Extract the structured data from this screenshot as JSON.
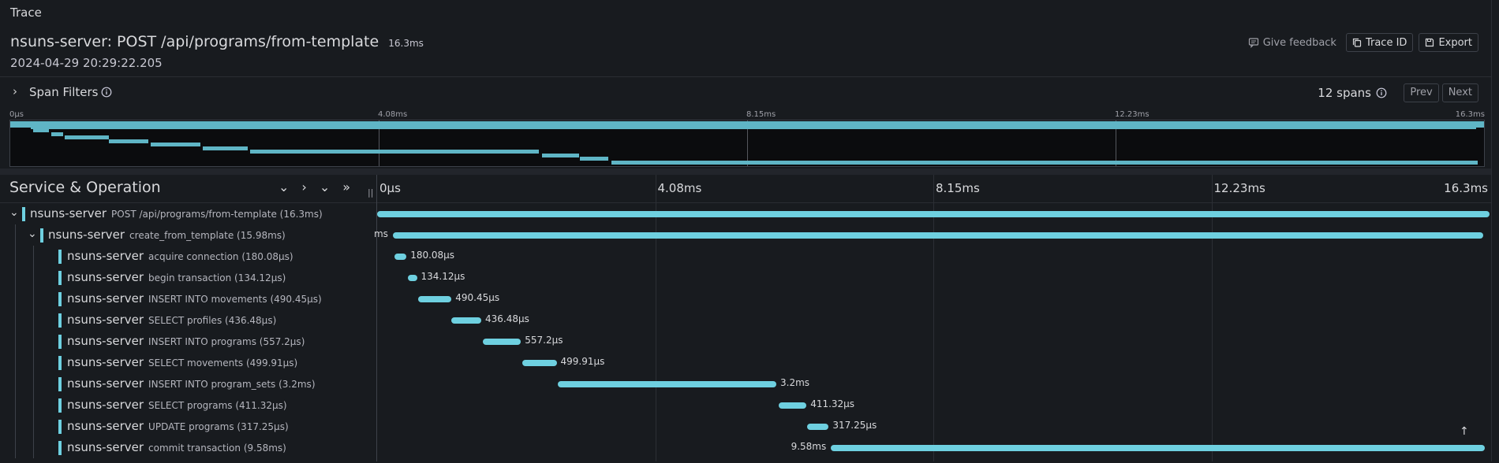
{
  "panel_title": "Trace",
  "header": {
    "service": "nsuns-server:",
    "operation": "POST /api/programs/from-template",
    "duration": "16.3ms",
    "start_time": "2024-04-29 20:29:22.205",
    "feedback_label": "Give feedback",
    "trace_id_label": "Trace ID",
    "export_label": "Export"
  },
  "filters": {
    "label": "Span Filters",
    "spans_count": "12 spans",
    "prev_label": "Prev",
    "next_label": "Next"
  },
  "minimap": {
    "ticks": [
      "0μs",
      "4.08ms",
      "8.15ms",
      "12.23ms",
      "16.3ms"
    ]
  },
  "columns": {
    "service_operation": "Service & Operation",
    "ticks": [
      "0μs",
      "4.08ms",
      "8.15ms",
      "12.23ms",
      "16.3ms"
    ]
  },
  "total_ms": 16.3,
  "spans": [
    {
      "service": "nsuns-server",
      "operation": "POST /api/programs/from-template (16.3ms)",
      "depth": 0,
      "collapsible": true,
      "start_ms": 0.0,
      "duration_ms": 16.3,
      "label": ""
    },
    {
      "service": "nsuns-server",
      "operation": "create_from_template (15.98ms)",
      "depth": 1,
      "collapsible": true,
      "start_ms": 0.23,
      "duration_ms": 15.98,
      "label": "ms"
    },
    {
      "service": "nsuns-server",
      "operation": "acquire connection (180.08μs)",
      "depth": 2,
      "collapsible": false,
      "start_ms": 0.25,
      "duration_ms": 0.18,
      "label": "180.08μs"
    },
    {
      "service": "nsuns-server",
      "operation": "begin transaction (134.12μs)",
      "depth": 2,
      "collapsible": false,
      "start_ms": 0.45,
      "duration_ms": 0.134,
      "label": "134.12μs"
    },
    {
      "service": "nsuns-server",
      "operation": "INSERT INTO movements (490.45μs)",
      "depth": 2,
      "collapsible": false,
      "start_ms": 0.6,
      "duration_ms": 0.49,
      "label": "490.45μs"
    },
    {
      "service": "nsuns-server",
      "operation": "SELECT profiles (436.48μs)",
      "depth": 2,
      "collapsible": false,
      "start_ms": 1.09,
      "duration_ms": 0.436,
      "label": "436.48μs"
    },
    {
      "service": "nsuns-server",
      "operation": "INSERT INTO programs (557.2μs)",
      "depth": 2,
      "collapsible": false,
      "start_ms": 1.55,
      "duration_ms": 0.557,
      "label": "557.2μs"
    },
    {
      "service": "nsuns-server",
      "operation": "SELECT movements (499.91μs)",
      "depth": 2,
      "collapsible": false,
      "start_ms": 2.13,
      "duration_ms": 0.5,
      "label": "499.91μs"
    },
    {
      "service": "nsuns-server",
      "operation": "INSERT INTO program_sets (3.2ms)",
      "depth": 2,
      "collapsible": false,
      "start_ms": 2.65,
      "duration_ms": 3.2,
      "label": "3.2ms"
    },
    {
      "service": "nsuns-server",
      "operation": "SELECT programs (411.32μs)",
      "depth": 2,
      "collapsible": false,
      "start_ms": 5.88,
      "duration_ms": 0.411,
      "label": "411.32μs"
    },
    {
      "service": "nsuns-server",
      "operation": "UPDATE programs (317.25μs)",
      "depth": 2,
      "collapsible": false,
      "start_ms": 6.3,
      "duration_ms": 0.317,
      "label": "317.25μs"
    },
    {
      "service": "nsuns-server",
      "operation": "commit transaction (9.58ms)",
      "depth": 2,
      "collapsible": false,
      "start_ms": 6.65,
      "duration_ms": 9.58,
      "label": "9.58ms"
    }
  ],
  "colors": {
    "span": "#6ed0e0",
    "minimap_span": "#5fb5c5",
    "background": "#181b1f"
  }
}
